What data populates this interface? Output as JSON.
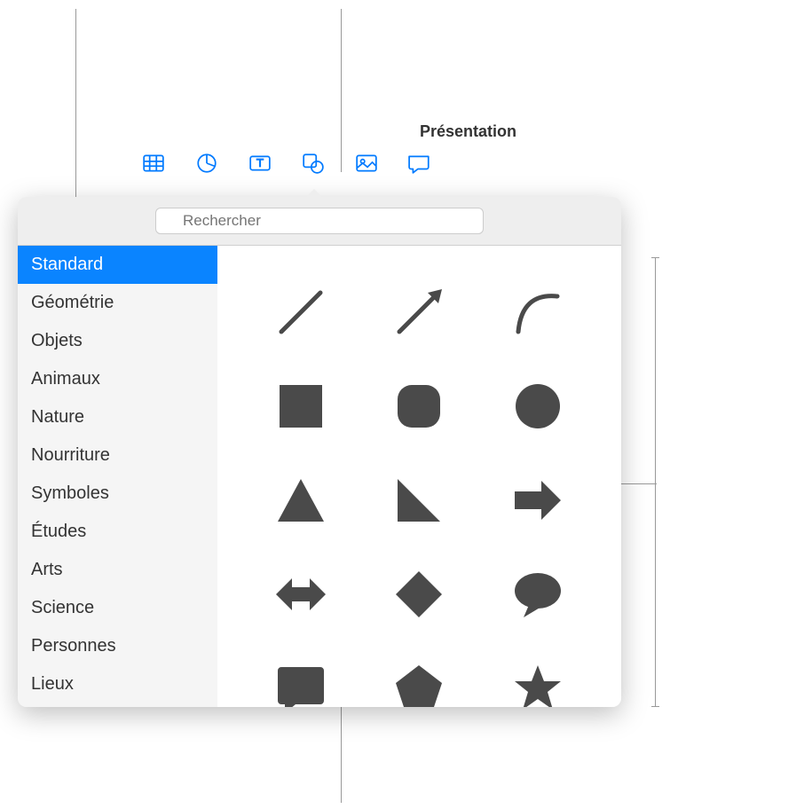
{
  "window": {
    "title": "Présentation"
  },
  "toolbar": {
    "icons": [
      "table-icon",
      "chart-icon",
      "textbox-icon",
      "shape-icon",
      "media-icon",
      "comment-icon"
    ]
  },
  "search": {
    "placeholder": "Rechercher"
  },
  "sidebar": {
    "items": [
      {
        "label": "Standard",
        "selected": true
      },
      {
        "label": "Géométrie",
        "selected": false
      },
      {
        "label": "Objets",
        "selected": false
      },
      {
        "label": "Animaux",
        "selected": false
      },
      {
        "label": "Nature",
        "selected": false
      },
      {
        "label": "Nourriture",
        "selected": false
      },
      {
        "label": "Symboles",
        "selected": false
      },
      {
        "label": "Études",
        "selected": false
      },
      {
        "label": "Arts",
        "selected": false
      },
      {
        "label": "Science",
        "selected": false
      },
      {
        "label": "Personnes",
        "selected": false
      },
      {
        "label": "Lieux",
        "selected": false
      }
    ]
  },
  "shapes": [
    {
      "name": "line-shape"
    },
    {
      "name": "arrow-line-shape"
    },
    {
      "name": "curve-shape"
    },
    {
      "name": "square-shape"
    },
    {
      "name": "rounded-square-shape"
    },
    {
      "name": "circle-shape"
    },
    {
      "name": "triangle-shape"
    },
    {
      "name": "right-triangle-shape"
    },
    {
      "name": "arrow-right-shape"
    },
    {
      "name": "double-arrow-shape"
    },
    {
      "name": "diamond-shape"
    },
    {
      "name": "speech-bubble-shape"
    },
    {
      "name": "callout-square-shape"
    },
    {
      "name": "pentagon-shape"
    },
    {
      "name": "star-shape"
    }
  ]
}
